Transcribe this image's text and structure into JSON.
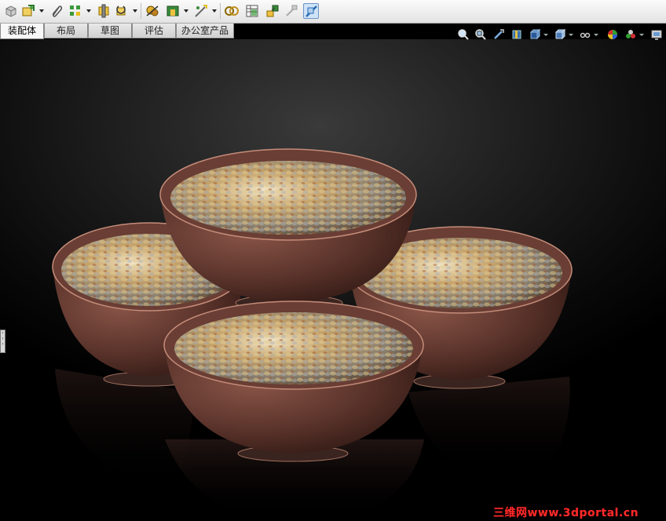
{
  "toolbar": {
    "buttons": [
      {
        "name": "new-part-icon"
      },
      {
        "name": "insert-component-icon",
        "dropdown": true
      },
      {
        "name": "mate-icon"
      },
      {
        "name": "linear-pattern-icon",
        "dropdown": true
      },
      {
        "name": "smart-fastener-icon"
      },
      {
        "name": "move-component-icon",
        "dropdown": true
      },
      {
        "name": "hide-show-components-icon"
      },
      {
        "name": "assembly-features-icon",
        "dropdown": true
      },
      {
        "name": "reference-geometry-icon",
        "dropdown": true
      },
      {
        "name": "new-motion-study-icon"
      },
      {
        "name": "bill-of-materials-icon"
      },
      {
        "name": "exploded-view-icon"
      },
      {
        "name": "explode-line-sketch-icon"
      },
      {
        "name": "interference-detection-icon",
        "active": true
      }
    ]
  },
  "tabs": [
    {
      "label": "装配体",
      "active": true
    },
    {
      "label": "布局"
    },
    {
      "label": "草图"
    },
    {
      "label": "评估"
    },
    {
      "label": "办公室产品"
    }
  ],
  "heads_up": [
    "zoom-to-fit-icon",
    "zoom-to-area-icon",
    "previous-view-icon",
    "section-view-icon",
    "view-orientation-icon",
    "display-style-icon",
    "hide-show-items-icon",
    "edit-appearance-icon",
    "apply-scene-icon",
    "view-settings-icon"
  ],
  "watermark": "三维网www.3dportal.cn",
  "colors": {
    "toolbar_bg": "#ececec",
    "scene_bg": "#000000",
    "bowl": "#6b3f36",
    "rim": "#b07a6c",
    "watermark": "#ff2a2a"
  }
}
